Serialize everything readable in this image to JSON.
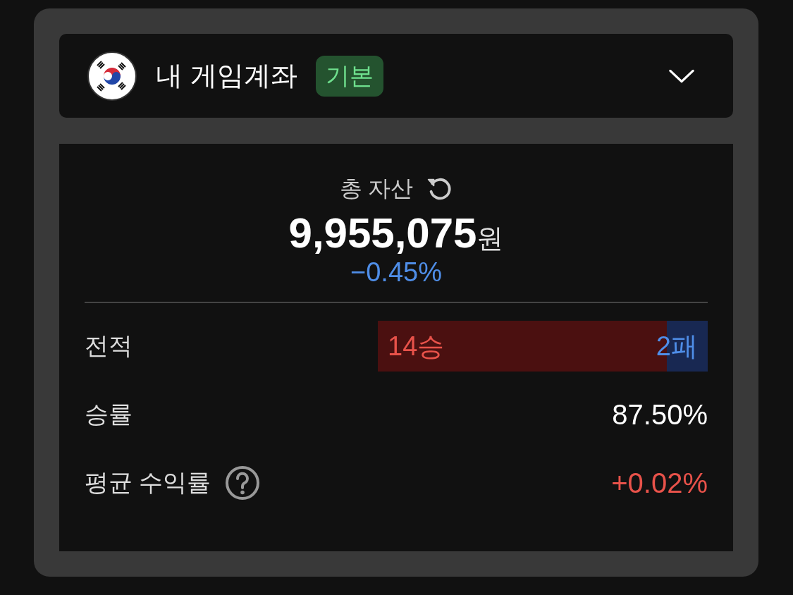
{
  "account": {
    "name": "내 게임계좌",
    "badge": "기본",
    "expanded": false
  },
  "total_assets": {
    "label": "총 자산",
    "amount": "9,955,075",
    "unit": "원",
    "change": {
      "text": "−0.45%",
      "color": "#4f8ee8"
    }
  },
  "record": {
    "label": "전적",
    "wins": "14승",
    "losses": "2패",
    "level": 0.875
  },
  "stats": [
    {
      "label": "승률",
      "value": "87.50%",
      "color": "#ffffff",
      "help": false
    },
    {
      "label": "평균 수익률",
      "value": "+0.02%",
      "color": "#e8524a",
      "help": true
    }
  ]
}
